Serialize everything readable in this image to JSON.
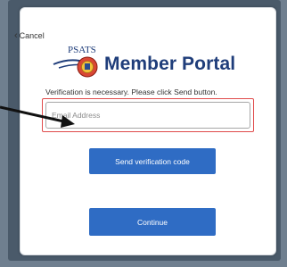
{
  "dialog": {
    "cancel_label": "Cancel",
    "logo_text": "PSATS",
    "portal_title": "Member Portal",
    "verification_message": "Verification is necessary. Please click Send button.",
    "email_placeholder": "Email Address",
    "send_button_label": "Send verification code",
    "continue_button_label": "Continue"
  },
  "colors": {
    "accent": "#2f6cc4",
    "title": "#1f3d7a",
    "highlight_border": "#e04b4b"
  },
  "icons": [
    "chevron-left-icon",
    "psats-logo",
    "annotation-arrow"
  ]
}
